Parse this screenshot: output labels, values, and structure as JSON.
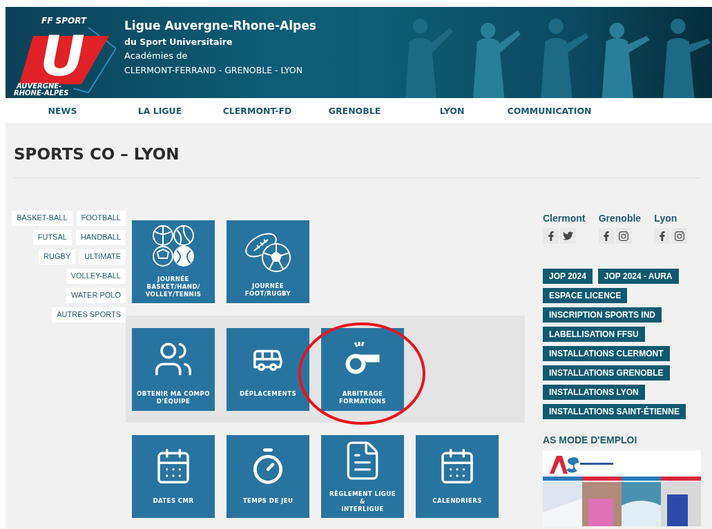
{
  "header": {
    "logo": {
      "top_text": "FF SPORT",
      "letter": "U",
      "bottom_lines": [
        "AUVERGNE-",
        "RHONE-ALPES"
      ]
    },
    "title": "Ligue Auvergne-Rhone-Alpes",
    "subtitle": "du Sport Universitaire",
    "academies_label": "Académies de",
    "academies": "CLERMONT-FERRAND - GRENOBLE - LYON"
  },
  "nav": {
    "items": [
      {
        "label": "NEWS"
      },
      {
        "label": "LA LIGUE"
      },
      {
        "label": "CLERMONT-FD"
      },
      {
        "label": "GRENOBLE"
      },
      {
        "label": "LYON"
      },
      {
        "label": "COMMUNICATION"
      }
    ]
  },
  "page_title": "SPORTS CO – LYON",
  "sport_tags": [
    [
      "BASKET-BALL",
      "FOOTBALL"
    ],
    [
      "FUTSAL",
      "HANDBALL"
    ],
    [
      "RUGBY",
      "ULTIMATE"
    ],
    [
      "VOLLEY-BALL"
    ],
    [
      "WATER POLO"
    ],
    [
      "AUTRES SPORTS"
    ]
  ],
  "tile_groups": [
    {
      "highlighted": false,
      "tiles": [
        {
          "kind": "balls",
          "lines": [
            "JOURNÉE",
            "BASKET/HAND/",
            "VOLLEY/TENNIS"
          ],
          "circled": false
        },
        {
          "kind": "rugby",
          "lines": [
            "JOURNÉE",
            "FOOT/RUGBY"
          ],
          "circled": false
        }
      ]
    },
    {
      "highlighted": true,
      "tiles": [
        {
          "kind": "team",
          "lines": [
            "OBTENIR MA COMPO",
            "D'ÉQUIPE"
          ],
          "circled": false
        },
        {
          "kind": "bus",
          "lines": [
            "DÉPLACEMENTS"
          ],
          "circled": false
        },
        {
          "kind": "whistle",
          "lines": [
            "ARBITRAGE",
            "FORMATIONS"
          ],
          "circled": true
        }
      ]
    },
    {
      "highlighted": false,
      "tiles": [
        {
          "kind": "calendar",
          "lines": [
            "DATES CMR"
          ],
          "circled": false
        },
        {
          "kind": "stopwatch",
          "lines": [
            "TEMPS DE JEU"
          ],
          "circled": false
        },
        {
          "kind": "document",
          "lines": [
            "RÈGLEMENT LIGUE",
            "&",
            "INTERLIGUE"
          ],
          "circled": false
        },
        {
          "kind": "calendar",
          "lines": [
            "CALENDRIERS"
          ],
          "circled": false
        }
      ]
    }
  ],
  "social": [
    {
      "city": "Clermont",
      "networks": [
        {
          "kind": "facebook"
        },
        {
          "kind": "twitter"
        }
      ]
    },
    {
      "city": "Grenoble",
      "networks": [
        {
          "kind": "facebook"
        },
        {
          "kind": "instagram"
        }
      ]
    },
    {
      "city": "Lyon",
      "networks": [
        {
          "kind": "facebook"
        },
        {
          "kind": "instagram"
        }
      ]
    }
  ],
  "quick_links": [
    [
      "JOP 2024",
      "JOP 2024 - AURA"
    ],
    [
      "ESPACE LICENCE"
    ],
    [
      "INSCRIPTION SPORTS IND"
    ],
    [
      "LABELLISATION FFSU"
    ],
    [
      "INSTALLATIONS CLERMONT"
    ],
    [
      "INSTALLATIONS GRENOBLE"
    ],
    [
      "INSTALLATIONS LYON"
    ],
    [
      "INSTALLATIONS SAINT-ÉTIENNE"
    ]
  ],
  "as_section": {
    "heading": "AS MODE D'EMPLOI"
  }
}
